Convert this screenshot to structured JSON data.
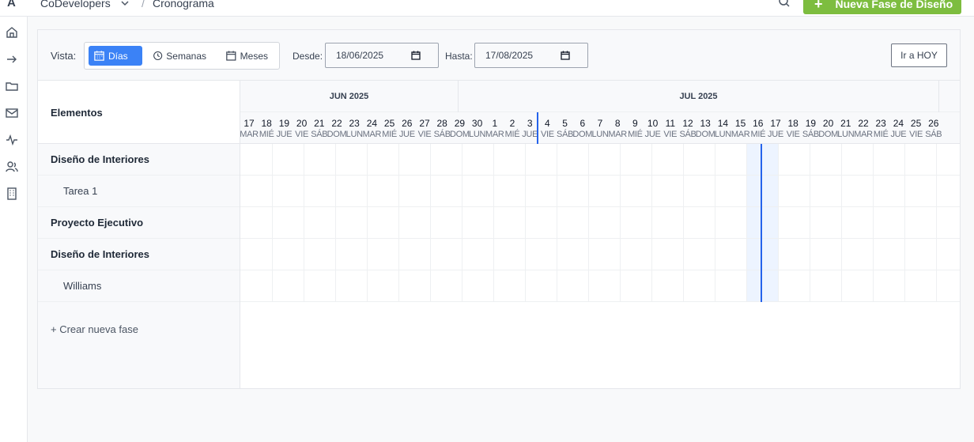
{
  "topbar": {
    "logo": "A",
    "organization": "CoDevelopers",
    "separator": "/",
    "page": "Cronograma",
    "new_phase_button": "Nueva Fase de Diseño",
    "new_phase_plus": "+"
  },
  "sidebar": {
    "icons": [
      "home-icon",
      "arrow-right-icon",
      "folder-icon",
      "mail-icon",
      "activity-icon",
      "users-icon",
      "building-icon"
    ]
  },
  "controls": {
    "vista_label": "Vista:",
    "views": [
      {
        "label": "Días",
        "active": true,
        "icon": "calendar-icon"
      },
      {
        "label": "Semanas",
        "active": false,
        "icon": "clock-icon"
      },
      {
        "label": "Meses",
        "active": false,
        "icon": "calendar-icon"
      }
    ],
    "desde_label": "Desde:",
    "desde_value": "18/06/2025",
    "hasta_label": "Hasta:",
    "hasta_value": "17/08/2025",
    "hoy_button": "Ir a HOY"
  },
  "elements": {
    "header": "Elementos",
    "rows": [
      {
        "label": "Diseño de Interiores",
        "kind": "phase"
      },
      {
        "label": "Tarea 1",
        "kind": "task"
      },
      {
        "label": "Proyecto Ejecutivo",
        "kind": "phase"
      },
      {
        "label": "Diseño de Interiores",
        "kind": "phase"
      },
      {
        "label": "Williams",
        "kind": "task"
      }
    ],
    "create_link": "+ Crear nueva fase"
  },
  "timeline": {
    "months": [
      {
        "label": "JUN 2025",
        "days": 14
      },
      {
        "label": "JUL 2025",
        "days": 26
      }
    ],
    "days": [
      {
        "n": "17",
        "w": "MAR"
      },
      {
        "n": "18",
        "w": "MIÉ"
      },
      {
        "n": "19",
        "w": "JUE"
      },
      {
        "n": "20",
        "w": "VIE"
      },
      {
        "n": "21",
        "w": "SÁB"
      },
      {
        "n": "22",
        "w": "DOM"
      },
      {
        "n": "23",
        "w": "LUN"
      },
      {
        "n": "24",
        "w": "MAR"
      },
      {
        "n": "25",
        "w": "MIÉ"
      },
      {
        "n": "26",
        "w": "JUE"
      },
      {
        "n": "27",
        "w": "VIE"
      },
      {
        "n": "28",
        "w": "SÁB"
      },
      {
        "n": "29",
        "w": "DOM"
      },
      {
        "n": "30",
        "w": "LUN"
      },
      {
        "n": "1",
        "w": "MAR"
      },
      {
        "n": "2",
        "w": "MIÉ"
      },
      {
        "n": "3",
        "w": "JUE"
      },
      {
        "n": "4",
        "w": "VIE"
      },
      {
        "n": "5",
        "w": "SÁB"
      },
      {
        "n": "6",
        "w": "DOM"
      },
      {
        "n": "7",
        "w": "LUN"
      },
      {
        "n": "8",
        "w": "MAR"
      },
      {
        "n": "9",
        "w": "MIÉ"
      },
      {
        "n": "10",
        "w": "JUE"
      },
      {
        "n": "11",
        "w": "VIE"
      },
      {
        "n": "12",
        "w": "SÁB"
      },
      {
        "n": "13",
        "w": "DOM"
      },
      {
        "n": "14",
        "w": "LUN"
      },
      {
        "n": "15",
        "w": "MAR"
      },
      {
        "n": "16",
        "w": "MIÉ"
      },
      {
        "n": "17",
        "w": "JUE"
      },
      {
        "n": "18",
        "w": "VIE"
      },
      {
        "n": "19",
        "w": "SÁB"
      },
      {
        "n": "20",
        "w": "DOM"
      },
      {
        "n": "21",
        "w": "LUN"
      },
      {
        "n": "22",
        "w": "MAR"
      },
      {
        "n": "23",
        "w": "MIÉ"
      },
      {
        "n": "24",
        "w": "JUE"
      },
      {
        "n": "25",
        "w": "VIE"
      },
      {
        "n": "26",
        "w": "SÁB"
      }
    ],
    "marker_day_index": 16,
    "today_index": 28,
    "accent": "#3b82f6",
    "brand_green": "#7dbd3f"
  }
}
